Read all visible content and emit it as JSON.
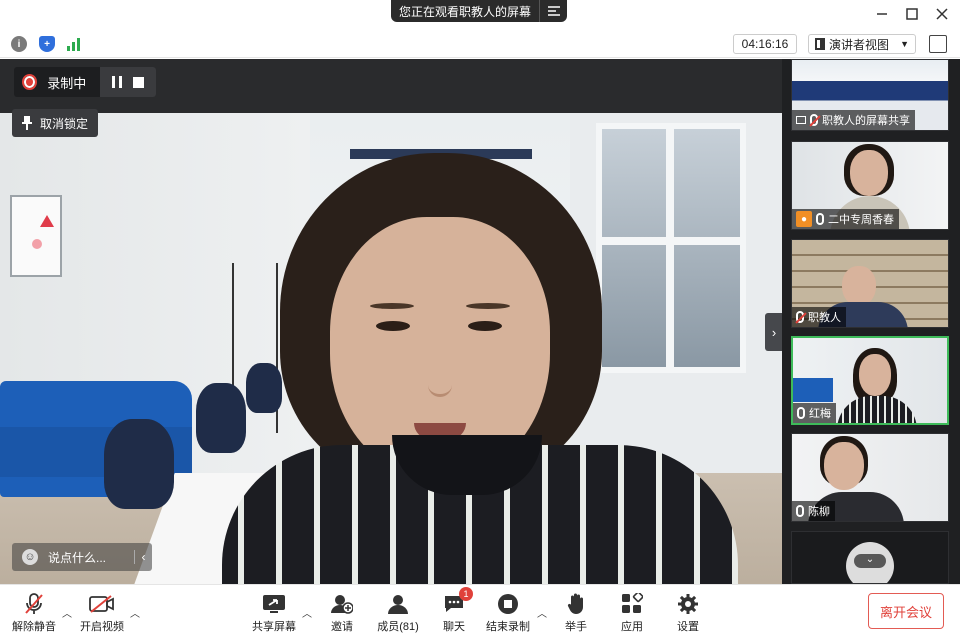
{
  "titlebar": {
    "share_notice": "您正在观看职教人的屏幕",
    "share_menu_icon": "list-menu-icon",
    "minimize_icon": "minimize-icon",
    "maximize_icon": "maximize-icon",
    "close_icon": "close-icon"
  },
  "infobar": {
    "timer": "04:16:16",
    "view_label": "演讲者视图",
    "icons": [
      "info-icon",
      "shield-icon",
      "signal-icon",
      "fullscreen-icon"
    ]
  },
  "main": {
    "recording_label": "录制中",
    "unpin_label": "取消锁定",
    "chat_placeholder": "说点什么..."
  },
  "sidebar": {
    "tiles": [
      {
        "label": "职教人的屏幕共享"
      },
      {
        "label": "二中专周香春"
      },
      {
        "label": "职教人"
      },
      {
        "label": "红梅"
      },
      {
        "label": "陈柳"
      }
    ]
  },
  "toolbar": {
    "unmute_label": "解除静音",
    "start_video_label": "开启视频",
    "share_screen_label": "共享屏幕",
    "invite_label": "邀请",
    "members_label": "成员(81)",
    "chat_label": "聊天",
    "chat_badge": "1",
    "end_record_label": "结束录制",
    "raise_hand_label": "举手",
    "apps_label": "应用",
    "settings_label": "设置",
    "leave_label": "离开会议"
  },
  "colors": {
    "accent_red": "#e0413a",
    "active_border": "#3ebb5a",
    "sofa_blue": "#1d5fb8"
  }
}
